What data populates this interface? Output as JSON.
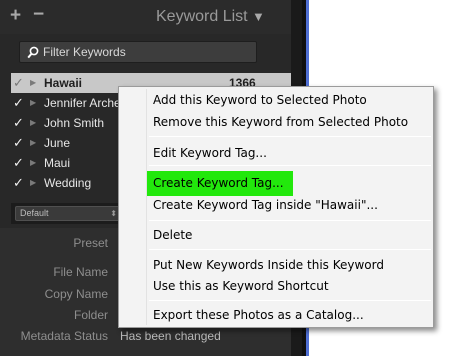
{
  "panel": {
    "title": "Keyword List",
    "add_label": "+",
    "remove_label": "−",
    "collapse_glyph": "▼"
  },
  "filter": {
    "placeholder": "Filter Keywords"
  },
  "keywords": [
    {
      "label": "Hawaii",
      "count": "1366",
      "checked": true,
      "selected": true
    },
    {
      "label": "Jennifer Arche",
      "count": "",
      "checked": true,
      "selected": false
    },
    {
      "label": "John Smith",
      "count": "",
      "checked": true,
      "selected": false
    },
    {
      "label": "June",
      "count": "",
      "checked": true,
      "selected": false
    },
    {
      "label": "Maui",
      "count": "",
      "checked": true,
      "selected": false
    },
    {
      "label": "Wedding",
      "count": "",
      "checked": true,
      "selected": false
    }
  ],
  "preset_bar": {
    "value": "Default"
  },
  "metadata": {
    "preset_label": "Preset",
    "file_name_label": "File Name",
    "copy_name_label": "Copy Name",
    "folder_label": "Folder",
    "status_label": "Metadata Status",
    "status_value": "Has been changed"
  },
  "context_menu": {
    "items": [
      "Add this Keyword to Selected Photo",
      "Remove this Keyword from Selected Photo",
      "Edit Keyword Tag...",
      "Create Keyword Tag...",
      "Create Keyword Tag inside \"Hawaii\"...",
      "Delete",
      "Put New Keywords Inside this Keyword",
      "Use this as Keyword Shortcut",
      "Export these Photos as a Catalog..."
    ],
    "highlight_color": "#22e80c"
  },
  "colors": {
    "panel_bg": "#282828",
    "selected_row_bg": "#c8c8c8",
    "menu_bg": "#f3f3f3",
    "accent_blue": "#4f6fd4"
  },
  "icons": {
    "filter": "magnifier-icon",
    "check": "checkmark-icon",
    "disclosure": "disclosure-triangle-icon"
  }
}
